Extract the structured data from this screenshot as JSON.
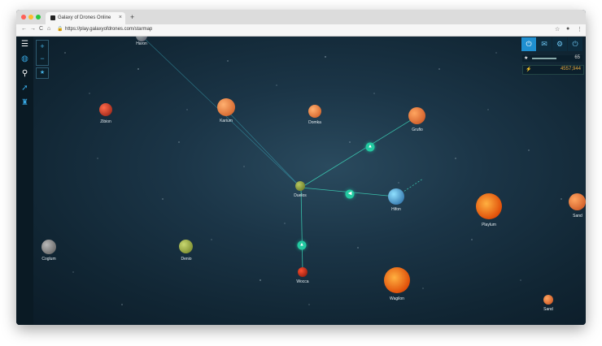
{
  "browser": {
    "tab_title": "Galaxy of Drones Online",
    "tab_close": "×",
    "new_tab": "+",
    "back": "←",
    "forward": "→",
    "reload": "C",
    "home": "⌂",
    "lock": "🔒",
    "url": "https://play.galaxyofdrones.com/starmap",
    "bookmark": "☆",
    "profile": "●",
    "menu": "⋮",
    "traffic_colors": [
      "#ff5f57",
      "#febc2e",
      "#28c840"
    ]
  },
  "sidebar": {
    "items": [
      {
        "icon": "menu-icon",
        "glyph": "☰"
      },
      {
        "icon": "globe-icon",
        "glyph": "◍"
      },
      {
        "icon": "satellite-icon",
        "glyph": "⚲"
      },
      {
        "icon": "rocket-icon",
        "glyph": "➚"
      },
      {
        "icon": "trophy-icon",
        "glyph": "♜"
      }
    ]
  },
  "map_controls": {
    "zoom_in": "+",
    "zoom_out": "−",
    "favorite": "★"
  },
  "hud": {
    "power": "⏻",
    "mail": "✉",
    "settings": "⚙",
    "logout": "⏻",
    "energy_icon": "★",
    "energy_value": "65",
    "credits_icon": "⚡",
    "credits_value": "4557,944"
  },
  "planets": [
    {
      "name": "Haron"
    },
    {
      "name": "Zibion"
    },
    {
      "name": "Karium"
    },
    {
      "name": "Domka"
    },
    {
      "name": "Grufio"
    },
    {
      "name": "Duelos"
    },
    {
      "name": "Hifon"
    },
    {
      "name": "Playlum"
    },
    {
      "name": "Sand"
    },
    {
      "name": "Coglum"
    },
    {
      "name": "Denio"
    },
    {
      "name": "Wocca"
    },
    {
      "name": "Wagilon"
    },
    {
      "name": "Sand"
    }
  ],
  "markers": [
    {
      "icon": "ship-icon",
      "glyph": "▲"
    },
    {
      "icon": "ship-icon",
      "glyph": "◀"
    },
    {
      "icon": "ship-icon",
      "glyph": "▲"
    }
  ],
  "colors": {
    "accent": "#23c9a1",
    "ui_blue": "#37a6e0",
    "credits": "#e5a83d"
  }
}
